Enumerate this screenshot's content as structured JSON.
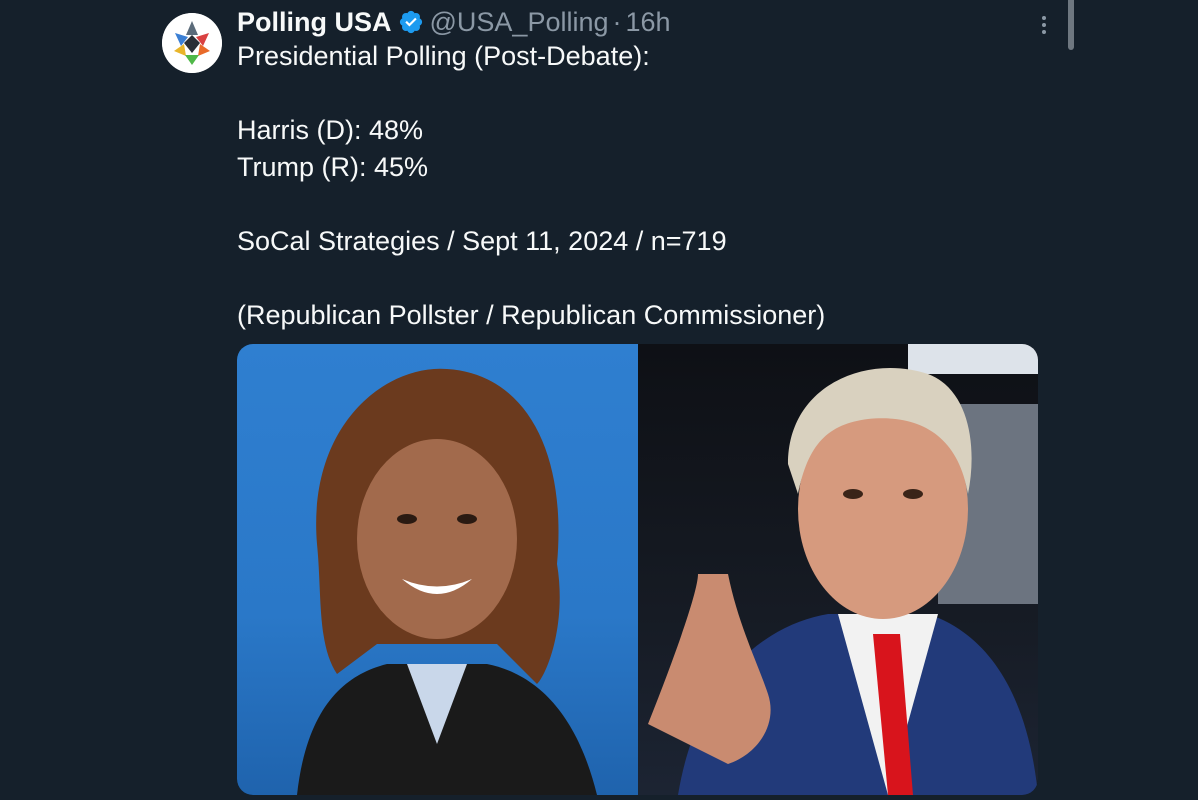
{
  "tweet": {
    "author": {
      "display_name": "Polling USA",
      "verified": true,
      "handle": "@USA_Polling",
      "separator": "·",
      "time": "16h",
      "avatar_icon": "polling-usa-logo"
    },
    "text_lines": [
      "Presidential Polling (Post-Debate):",
      "",
      "Harris (D): 48%",
      "Trump (R): 45%",
      "",
      "SoCal Strategies / Sept 11, 2024 / n=719",
      "",
      "(Republican Pollster / Republican Commissioner)"
    ],
    "media": {
      "left_photo": "harris-photo",
      "right_photo": "trump-photo"
    },
    "more_icon": "more-options-icon"
  },
  "colors": {
    "background": "#15202b",
    "text_primary": "#f7f9f9",
    "text_secondary": "#8b98a5",
    "verified_badge": "#1d9bf0"
  }
}
